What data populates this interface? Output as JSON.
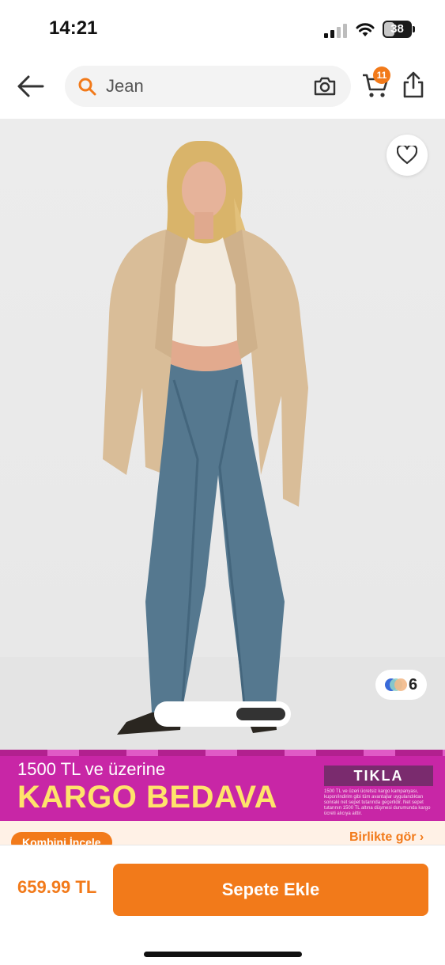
{
  "status_bar": {
    "time": "14:21",
    "battery": "38",
    "battery_level_percent": 38,
    "icons": [
      "cellular-signal-icon",
      "wifi-icon",
      "battery-icon"
    ]
  },
  "header": {
    "search_value": "Jean",
    "cart_badge": "11",
    "icons": [
      "back-arrow-icon",
      "search-icon",
      "camera-icon",
      "cart-icon",
      "share-icon"
    ]
  },
  "product_image": {
    "color_count": "6",
    "image_pager": {
      "total": 2,
      "current": 2
    },
    "icons": [
      "heart-icon",
      "color-swatch-icon"
    ]
  },
  "campaign_banner": {
    "line1": "1500 TL ve üzerine",
    "headline": "KARGO BEDAVA",
    "cta": "TIKLA",
    "note": "1500 TL ve üzeri ücretsiz kargo kampanyası, kupon/indirim gibi tüm avantajlar uygulandıktan sonraki net sepet tutarında geçerlidir. Net sepet tutarının 1500 TL altına düşmesi durumunda kargo ücreti alıcıya aittir."
  },
  "combine_row": {
    "chip": "Kombini İncele",
    "link": "Birlikte gör"
  },
  "bottom_bar": {
    "price": "659.99 TL",
    "add_to_cart": "Sepete Ekle"
  },
  "colors": {
    "accent": "#f27a1a",
    "banner": "#c826a6",
    "banner_headline": "#ffe36b",
    "cta_bg": "#7a2b6e"
  }
}
